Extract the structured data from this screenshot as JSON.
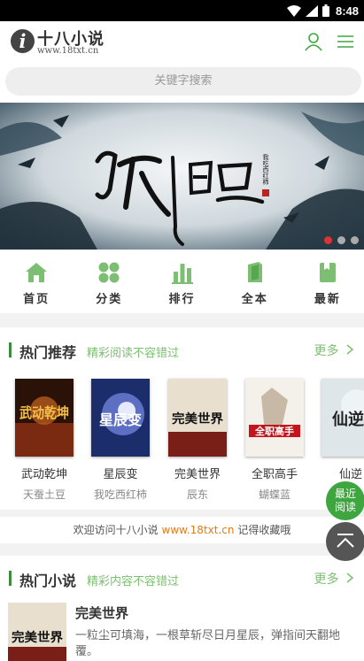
{
  "status_bar": {
    "time": "8:48"
  },
  "header": {
    "logo_name": "十八小说",
    "logo_url": "www.18txt.cn",
    "icons": [
      "user-icon",
      "menu-icon"
    ]
  },
  "search": {
    "placeholder": "关键字搜索"
  },
  "banner": {
    "title_art": "飞剑问道",
    "author_art": "我吃西红柿",
    "slide_count": 3,
    "active_slide": 1
  },
  "nav": [
    {
      "label": "首页",
      "icon": "home-icon"
    },
    {
      "label": "分类",
      "icon": "category-icon"
    },
    {
      "label": "排行",
      "icon": "ranking-icon"
    },
    {
      "label": "全本",
      "icon": "complete-icon"
    },
    {
      "label": "最新",
      "icon": "latest-icon"
    }
  ],
  "hot_recommend": {
    "title": "热门推荐",
    "subtitle": "精彩阅读不容错过",
    "more": "更多",
    "books": [
      {
        "name": "武动乾坤",
        "author": "天蚕土豆",
        "cover_text": "武动乾坤"
      },
      {
        "name": "星辰变",
        "author": "我吃西红柿",
        "cover_text": "星辰变"
      },
      {
        "name": "完美世界",
        "author": "辰东",
        "cover_text": "完美世界"
      },
      {
        "name": "全职高手",
        "author": "蝴蝶蓝",
        "cover_text": "全职高手"
      },
      {
        "name": "仙逆",
        "author": "",
        "cover_text": "仙逆"
      }
    ]
  },
  "welcome": {
    "prefix": "欢迎访问十八小说",
    "site": "www.18txt.cn",
    "suffix": "记得收藏哦"
  },
  "floating": {
    "recent_line1": "最近",
    "recent_line2": "阅读"
  },
  "hot_novels": {
    "title": "热门小说",
    "subtitle": "精彩内容不容错过",
    "more": "更多",
    "items": [
      {
        "name": "完美世界",
        "desc": "一粒尘可填海，一根草斩尽日月星辰，弹指间天翻地覆。",
        "cover_text": "完美世界"
      }
    ]
  },
  "colors": {
    "accent": "#3fa53f",
    "link_orange": "#e07b1a",
    "dot_active": "#dd3333"
  }
}
